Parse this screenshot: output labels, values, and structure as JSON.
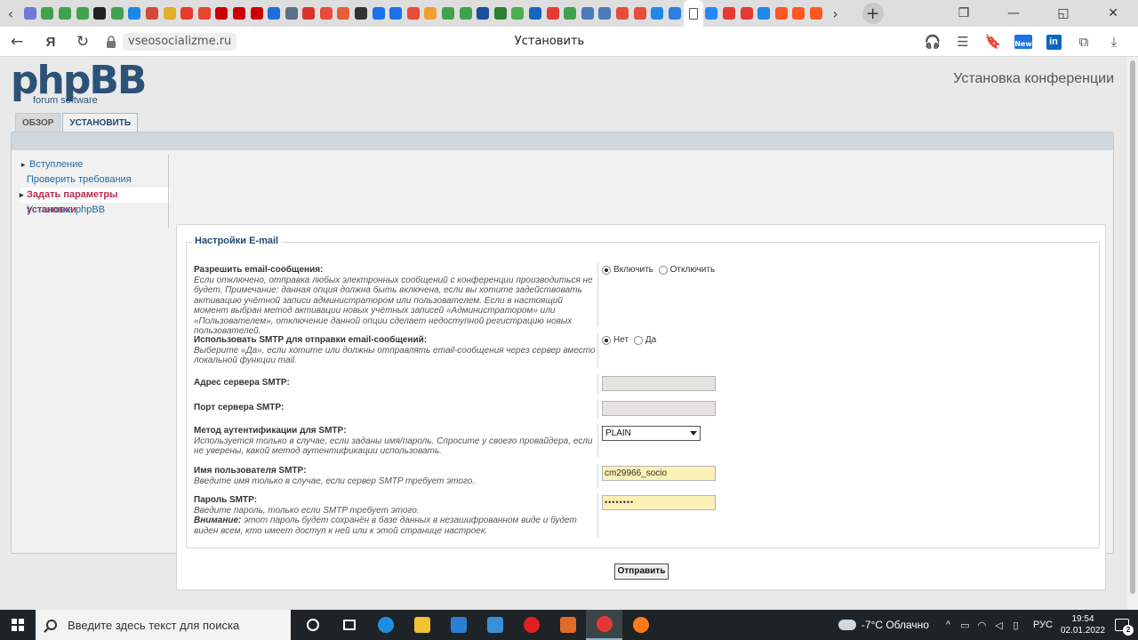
{
  "browser": {
    "pinned_tab_colors": [
      "#6b7bd6",
      "#3fa34d",
      "#3fa34d",
      "#3fa34d",
      "#222222",
      "#3fa34d",
      "#1a88e6",
      "#d64a3a",
      "#e0b02a",
      "#e63b2e",
      "#e6442e",
      "#cc0000",
      "#cc0000",
      "#cc0000",
      "#1e6fd9",
      "#5b6f85",
      "#d9342b",
      "#e74c3c",
      "#e85c3a",
      "#333333",
      "#1a73e8",
      "#1a73e8",
      "#e74c3c",
      "#f0a030",
      "#3fa34d",
      "#3fa34d",
      "#1a4e9e",
      "#2e7d32",
      "#4caf50",
      "#1565c0",
      "#e53935",
      "#3fa34d",
      "#4a7ab8",
      "#4a7ab8",
      "#e74c3c",
      "#e74c3c",
      "#1e88e5",
      "#2e7de0",
      "#ffffff",
      "#2787f5",
      "#e53935",
      "#e53935",
      "#1e88e5",
      "#ff5722",
      "#ff5722",
      "#ff5722"
    ],
    "domain": "vseosocializme.ru",
    "page_title": "Установить"
  },
  "header": {
    "logo_main": "phpBB",
    "logo_sub": "forum software",
    "title": "Установка конференции"
  },
  "tabs": [
    {
      "label": "ОБЗОР"
    },
    {
      "label": "УСТАНОВИТЬ"
    }
  ],
  "menu": {
    "items": [
      {
        "label": "Вступление"
      },
      {
        "label": "Проверить требования"
      },
      {
        "label": "Задать параметры установки"
      },
      {
        "label": "Установка phpBB"
      }
    ]
  },
  "form": {
    "legend": "Настройки E-mail",
    "email_enable": {
      "label": "Разрешить email-сообщения:",
      "desc": "Если отключено, отправка любых электронных сообщений с конференции производиться не будет. Примечание: данная опция должна быть включена, если вы хотите задействовать активацию учётной записи администратором или пользователем. Если в настоящий момент выбран метод активации новых учётных записей «Администратором» или «Пользователем», отключение данной опции сделает недоступной регистрацию новых пользователей.",
      "opt_on": "Включить",
      "opt_off": "Отключить"
    },
    "smtp_use": {
      "label": "Использовать SMTP для отправки email-сообщений:",
      "desc": "Выберите «Да», если хотите или должны отправлять email-сообщения через сервер вместо локальной функции mail.",
      "opt_no": "Нет",
      "opt_yes": "Да"
    },
    "smtp_host": {
      "label": "Адрес сервера SMTP:",
      "value": ""
    },
    "smtp_port": {
      "label": "Порт сервера SMTP:",
      "value": ""
    },
    "smtp_auth": {
      "label": "Метод аутентификации для SMTP:",
      "desc": "Используется только в случае, если заданы имя/пароль. Спросите у своего провайдера, если не уверены, какой метод аутентификации использовать.",
      "selected": "PLAIN"
    },
    "smtp_user": {
      "label": "Имя пользователя SMTP:",
      "desc": "Введите имя только в случае, если сервер SMTP требует этого.",
      "value": "cm29966_socio"
    },
    "smtp_pass": {
      "label": "Пароль SMTP:",
      "desc": "Введите пароль, только если SMTP требует этого.",
      "warn_label": "Внимание:",
      "warn_text": " этот пароль будет сохранён в базе данных в незашифрованном виде и будет виден всем, кто имеет доступ к ней или к этой странице настроек.",
      "value": "••••••••"
    },
    "submit_label": "Отправить"
  },
  "taskbar": {
    "search_placeholder": "Введите здесь текст для поиска",
    "app_colors": [
      "#ffffff",
      "#ffffff",
      "#1e8fe0",
      "#f2c230",
      "#2d7dd2",
      "#3b8fd9",
      "#e02020",
      "#e06a2a",
      "#e53935",
      "#ff7a1a"
    ],
    "weather": "-7°C  Облачно",
    "lang": "РУС",
    "time": "19:54",
    "date": "02.01.2022",
    "notif_count": "2"
  }
}
